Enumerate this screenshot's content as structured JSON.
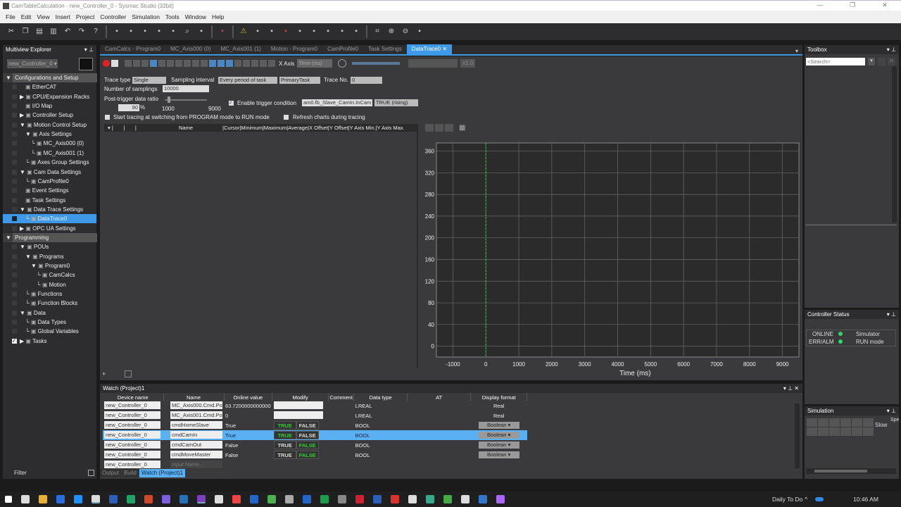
{
  "window": {
    "title": "CamTableCalculation - new_Controller_0 - Sysmac Studio (32bit)",
    "controls": [
      "—",
      "❐",
      "✕"
    ]
  },
  "menu": [
    "File",
    "Edit",
    "View",
    "Insert",
    "Project",
    "Controller",
    "Simulation",
    "Tools",
    "Window",
    "Help"
  ],
  "toolbar_icons": [
    "cut-icon",
    "copy-icon",
    "paste-icon",
    "delete-icon",
    "undo-icon",
    "redo-icon",
    "help-icon",
    "window-icon",
    "build-icon",
    "cross-reference-icon",
    "table-icon",
    "monitor-icon",
    "search-icon",
    "find-replace-icon",
    "online-icon",
    "warning-icon",
    "disable-icon",
    "glasses-icon",
    "synchronize-icon",
    "transfer-icon",
    "object-icon",
    "reset-icon",
    "io-icon",
    "io2-icon",
    "fit-icon",
    "zoom-in-icon",
    "zoom-out-icon",
    "zoom-reset-icon"
  ],
  "explorer": {
    "title": "Multiview Explorer",
    "controller": "new_Controller_0",
    "items": [
      {
        "label": "Configurations and Setup",
        "level": 0,
        "section": true
      },
      {
        "label": "EtherCAT",
        "level": 2
      },
      {
        "label": "CPU/Expansion Racks",
        "level": 1,
        "arrow": "▶"
      },
      {
        "label": "I/O Map",
        "level": 2
      },
      {
        "label": "Controller Setup",
        "level": 1,
        "arrow": "▶"
      },
      {
        "label": "Motion Control Setup",
        "level": 1,
        "arrow": "▼"
      },
      {
        "label": "Axis Settings",
        "level": 2,
        "arrow": "▼"
      },
      {
        "label": "MC_Axis000 (0)",
        "level": 3,
        "pre": "└"
      },
      {
        "label": "MC_Axis001 (1)",
        "level": 3,
        "pre": "└"
      },
      {
        "label": "Axes Group Settings",
        "level": 2,
        "pre": "└"
      },
      {
        "label": "Cam Data Settings",
        "level": 1,
        "arrow": "▼"
      },
      {
        "label": "CamProfile0",
        "level": 2,
        "pre": "└"
      },
      {
        "label": "Event Settings",
        "level": 2
      },
      {
        "label": "Task Settings",
        "level": 2
      },
      {
        "label": "Data Trace Settings",
        "level": 1,
        "arrow": "▼"
      },
      {
        "label": "DataTrace0",
        "level": 2,
        "pre": "└",
        "selected": true
      },
      {
        "label": "OPC UA Settings",
        "level": 1,
        "arrow": "▶"
      },
      {
        "label": "Programming",
        "level": 0,
        "section": true
      },
      {
        "label": "POUs",
        "level": 1,
        "arrow": "▼"
      },
      {
        "label": "Programs",
        "level": 2,
        "arrow": "▼"
      },
      {
        "label": "Program0",
        "level": 3,
        "arrow": "▼"
      },
      {
        "label": "CamCalcs",
        "level": 4,
        "pre": "└"
      },
      {
        "label": "Motion",
        "level": 4,
        "pre": "└"
      },
      {
        "label": "Functions",
        "level": 2,
        "pre": "└"
      },
      {
        "label": "Function Blocks",
        "level": 2,
        "pre": "└"
      },
      {
        "label": "Data",
        "level": 1,
        "arrow": "▼"
      },
      {
        "label": "Data Types",
        "level": 2,
        "pre": "└"
      },
      {
        "label": "Global Variables",
        "level": 2,
        "pre": "└"
      },
      {
        "label": "Tasks",
        "level": 1,
        "arrow": "▶",
        "checked": true
      }
    ],
    "filter": "Filter"
  },
  "tabs": [
    "CamCalcs - Program0",
    "MC_Axis000 (0)",
    "MC_Axis001 (1)",
    "Motion - Program0",
    "CamProfile0",
    "Task Settings",
    "DataTrace0"
  ],
  "trace": {
    "x_axis_label": "X Axis",
    "x_axis_value": "Time (ms)",
    "speed": "x1.0",
    "trace_type_label": "Trace type",
    "trace_type": "Single",
    "sampling_label": "Sampling interval",
    "sampling": "Every period of task",
    "task": "PrimaryTask",
    "trace_no_label": "Trace No.",
    "trace_no": "0",
    "samplings_label": "Number of samplings",
    "samplings": "10000",
    "ratio_label": "Post-trigger data ratio",
    "ratio": "90",
    "ratio_unit": "%",
    "ratio_min": "1000",
    "ratio_max": "9000",
    "ratio_fraction": 0.1,
    "trigger_label": "Enable trigger condition",
    "trigger_var": "am0.fb_Slave_CamIn.InCam",
    "trigger_cond": "TRUE (rising)",
    "start_label": "Start tracing at switching from PROGRAM mode to RUN mode",
    "refresh_label": "Refresh charts during tracing",
    "sig_name": "Name",
    "sig_cols": "|Cursor|Minimum|Maximum|Average|X Offset|Y Offset|Y Axis Min.|Y Axis Max."
  },
  "chart_data": {
    "type": "line",
    "xlabel": "Time (ms)",
    "ylabel": "",
    "xlim": [
      -1500,
      9500
    ],
    "ylim": [
      -20,
      375
    ],
    "xticks": [
      -1000,
      0,
      1000,
      2000,
      3000,
      4000,
      5000,
      6000,
      7000,
      8000,
      9000
    ],
    "yticks": [
      0,
      40,
      80,
      120,
      160,
      200,
      240,
      280,
      320,
      360
    ],
    "grid": true,
    "trigger_x": 0,
    "series": [],
    "trigger_color": "#3cbf3c"
  },
  "watch": {
    "title": "Watch (Project)1",
    "columns": [
      "Device name",
      "Name",
      "Online value",
      "Modify",
      "Comment",
      "Data type",
      "AT",
      "Display format"
    ],
    "rows": [
      {
        "device": "new_Controller_0",
        "name": "MC_Axis000.Cmd.Po",
        "value": "63.7200000000000",
        "modify": "input",
        "type": "LREAL",
        "format": "Real"
      },
      {
        "device": "new_Controller_0",
        "name": "MC_Axis001.Cmd.Po",
        "value": "0",
        "modify": "input",
        "type": "LREAL",
        "format": "Real"
      },
      {
        "device": "new_Controller_0",
        "name": "cmdHomeSlave",
        "value": "True",
        "modify": "true",
        "type": "BOOL",
        "format": "Boolean"
      },
      {
        "device": "new_Controller_0",
        "name": "cmdCamIn",
        "value": "True",
        "modify": "true",
        "type": "BOOL",
        "format": "Boolean",
        "selected": true
      },
      {
        "device": "new_Controller_0",
        "name": "cmdCamOut",
        "value": "False",
        "modify": "false",
        "type": "BOOL",
        "format": "Boolean"
      },
      {
        "device": "new_Controller_0",
        "name": "cmdMoveMaster",
        "value": "False",
        "modify": "false",
        "type": "BOOL",
        "format": "Boolean"
      }
    ],
    "new_row_device": "new_Controller_0",
    "new_row_placeholder": "Input Name...",
    "true_label": "TRUE",
    "false_label": "FALSE"
  },
  "bottom_tabs": [
    "Output",
    "Build",
    "Watch (Project)1"
  ],
  "toolbox": {
    "title": "Toolbox",
    "search_placeholder": "<Search>"
  },
  "status": {
    "title": "Controller Status",
    "rows": [
      {
        "label": "ONLINE",
        "value": "Simulator"
      },
      {
        "label": "ERR/ALM",
        "value": "RUN mode"
      }
    ]
  },
  "simulation": {
    "title": "Simulation",
    "slow": "Slow",
    "speed": "Spe"
  },
  "taskbar": {
    "daily": "Daily To Do",
    "time": "10:46 AM"
  }
}
